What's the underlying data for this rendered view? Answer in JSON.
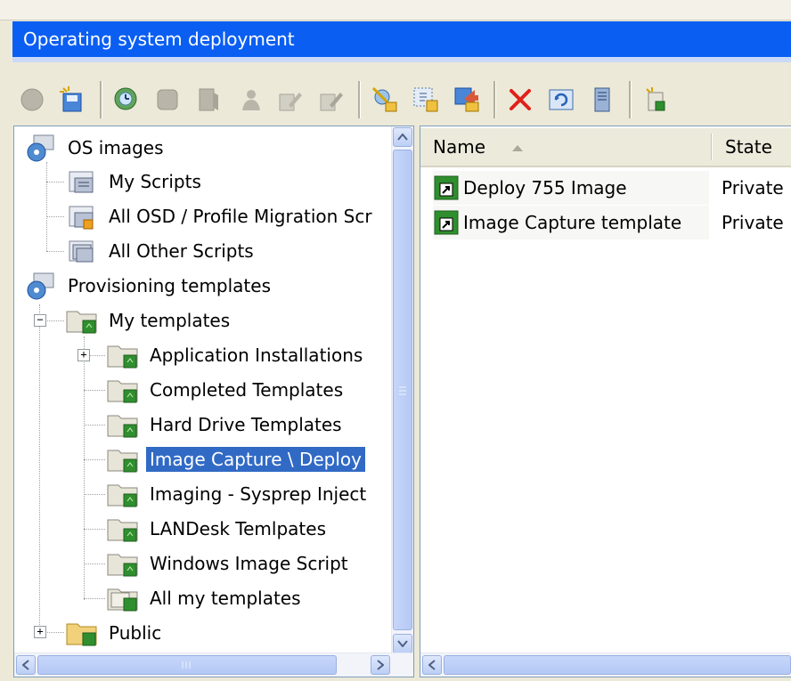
{
  "window": {
    "title": "Operating system deployment"
  },
  "toolbar": {
    "groups": [
      [
        "circle-disabled-icon",
        "new-script-icon"
      ],
      [
        "schedule-icon",
        "package-icon",
        "book-icon",
        "user-icon",
        "edit-icon",
        "edit-disabled-icon"
      ],
      [
        "configure-icon",
        "properties-icon",
        "migrate-icon",
        "delete-icon",
        "refresh-icon",
        "server-icon"
      ],
      [
        "new-template-icon"
      ]
    ]
  },
  "tree": {
    "items": [
      {
        "label": "OS images",
        "icon": "os-images-icon"
      },
      {
        "label": "My Scripts",
        "icon": "script-folder-icon"
      },
      {
        "label": "All OSD / Profile Migration Scr",
        "icon": "script-folder-icon"
      },
      {
        "label": "All Other Scripts",
        "icon": "script-folder-icon"
      },
      {
        "label": "Provisioning templates",
        "icon": "provisioning-icon"
      },
      {
        "label": "My templates",
        "icon": "template-folder-icon"
      },
      {
        "label": "Application Installations",
        "icon": "template-folder-icon"
      },
      {
        "label": "Completed Templates",
        "icon": "template-folder-icon"
      },
      {
        "label": "Hard Drive Templates",
        "icon": "template-folder-icon"
      },
      {
        "label": "Image Capture \\ Deploy",
        "icon": "template-folder-icon"
      },
      {
        "label": "Imaging - Sysprep Inject",
        "icon": "template-folder-icon"
      },
      {
        "label": "LANDesk Temlpates",
        "icon": "template-folder-icon"
      },
      {
        "label": "Windows Image Script",
        "icon": "template-folder-icon"
      },
      {
        "label": "All my templates",
        "icon": "template-folder-icon"
      },
      {
        "label": "Public",
        "icon": "public-folder-icon"
      }
    ],
    "selected": "Image Capture \\ Deploy",
    "expander_collapsed": "+",
    "expander_expanded": "−"
  },
  "list": {
    "columns": [
      "Name",
      "State"
    ],
    "rows": [
      {
        "name": "Deploy 755 Image",
        "state": "Private"
      },
      {
        "name": "Image Capture template",
        "state": "Private"
      }
    ]
  },
  "colors": {
    "title_bar": "#0a5ef2",
    "selection": "#316ac5",
    "window_bg": "#ece9d8"
  }
}
